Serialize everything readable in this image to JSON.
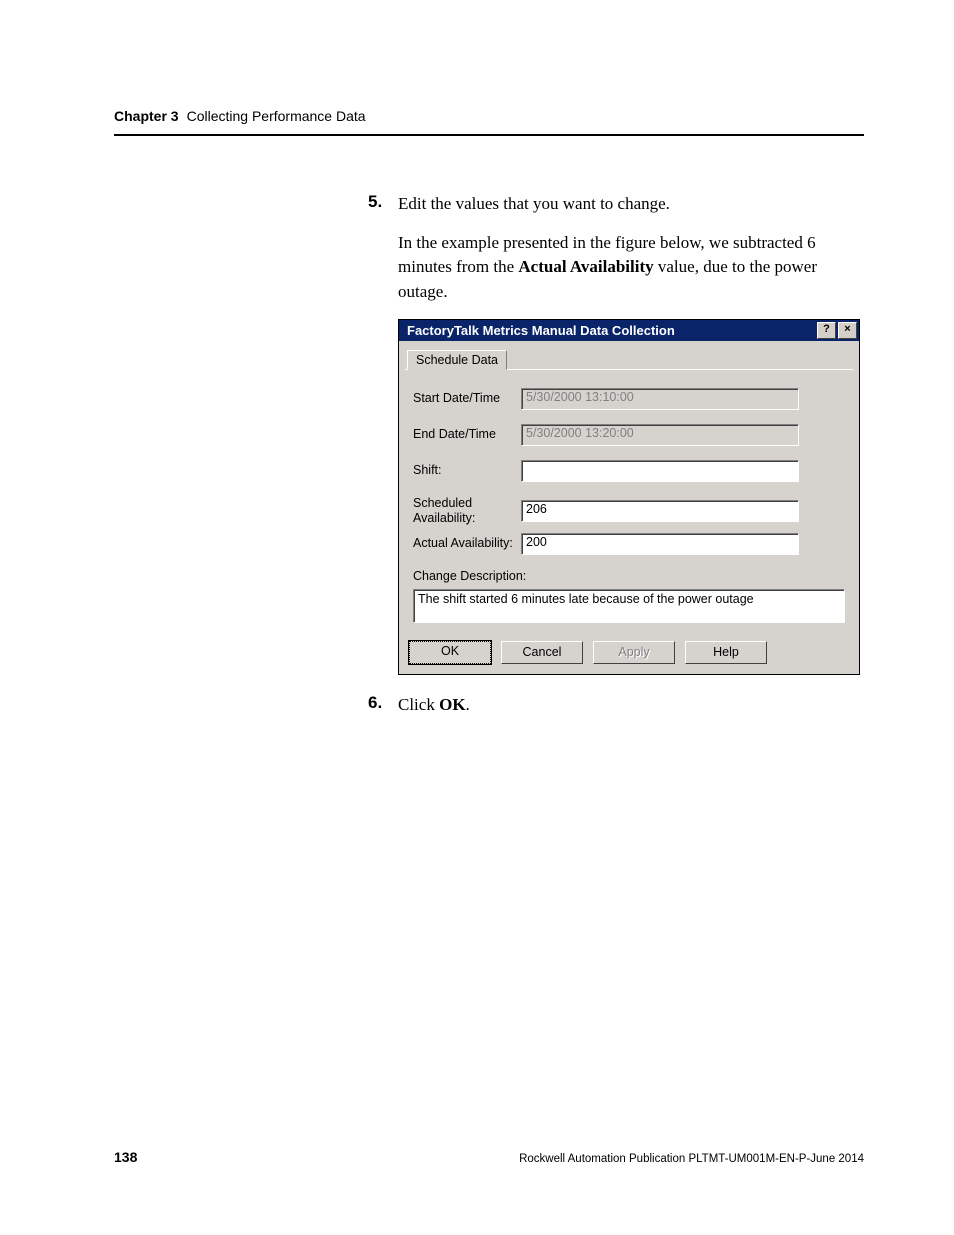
{
  "header": {
    "chapter_num": "Chapter 3",
    "chapter_title": "Collecting Performance Data"
  },
  "steps": {
    "s5": {
      "num": "5.",
      "line1": "Edit the values that you want to change.",
      "para2_a": "In the example presented in the figure below, we subtracted 6 minutes from the ",
      "para2_strong": "Actual Availability",
      "para2_b": " value, due to the power outage."
    },
    "s6": {
      "num": "6.",
      "text_a": "Click ",
      "text_strong": "OK",
      "text_b": "."
    }
  },
  "dialog": {
    "title": "FactoryTalk Metrics Manual Data Collection",
    "tab_label": "Schedule Data",
    "fields": {
      "start_label": "Start Date/Time",
      "start_value": "5/30/2000 13:10:00",
      "end_label": "End Date/Time",
      "end_value": "5/30/2000 13:20:00",
      "shift_label": "Shift:",
      "shift_value": "",
      "sched_label": "Scheduled Availability:",
      "sched_value": "206",
      "actual_label": "Actual Availability:",
      "actual_value": "200",
      "change_desc_label": "Change Description:",
      "change_desc_value": "The shift started 6 minutes late because of the power outage"
    },
    "buttons": {
      "ok": "OK",
      "cancel": "Cancel",
      "apply": "Apply",
      "help": "Help"
    },
    "titlebar_help": "?",
    "titlebar_close": "×"
  },
  "footer": {
    "page_no": "138",
    "publication": "Rockwell Automation Publication PLTMT-UM001M-EN-P-June 2014"
  }
}
